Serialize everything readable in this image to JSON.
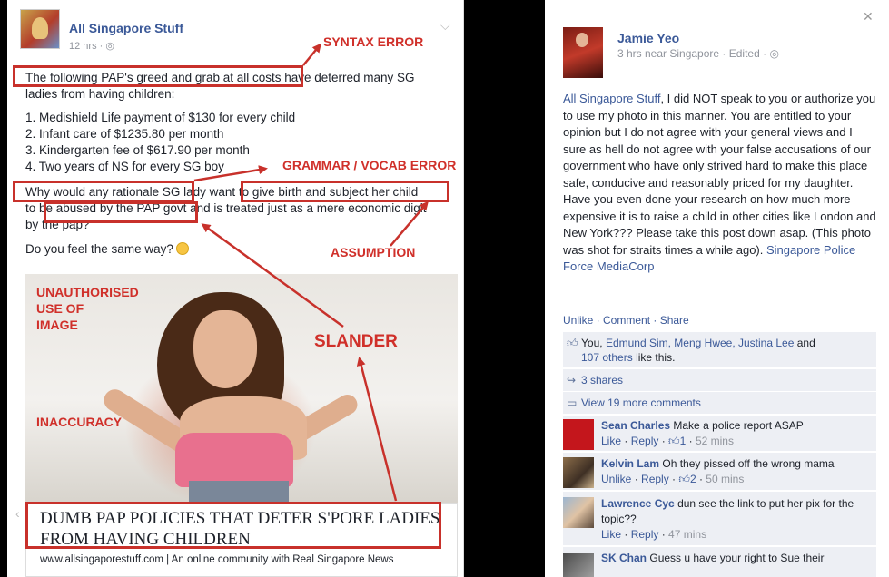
{
  "post": {
    "page_name": "All Singapore Stuff",
    "meta": "12 hrs · ",
    "text_lines": [
      "The following PAP's greed and grab at all costs have deterred many SG",
      "ladies from having children:"
    ],
    "list": [
      "1. Medishield Life payment of $130 for every child",
      "2. Infant care of $1235.80 per month",
      "3. Kindergarten fee of $617.90 per month",
      "4. Two years of NS for every SG boy"
    ],
    "text_lines_2": [
      "Why would any rationale SG lady want to give birth and subject her child",
      "to be abused by the PAP govt and is treated just as a mere economic digit",
      "by the pap?"
    ],
    "question": "Do you feel the same way?",
    "link_title_1": "DUMB PAP POLICIES THAT DETER S'PORE LADIES",
    "link_title_2": "FROM HAVING CHILDREN",
    "link_url": "www.allsingaporestuff.com | An online community with Real Singapore News"
  },
  "annotations": {
    "syntax": "SYNTAX ERROR",
    "grammar": "GRAMMAR / VOCAB ERROR",
    "assumption": "ASSUMPTION",
    "unauth_1": "UNAUTHORISED",
    "unauth_2": "USE OF",
    "unauth_3": "IMAGE",
    "slander": "SLANDER",
    "inaccuracy": "INACCURACY",
    "color": "#d0302a"
  },
  "reply": {
    "name": "Jamie Yeo",
    "meta": "3 hrs near Singapore · Edited · ",
    "body_link_1": "All Singapore Stuff",
    "body": ", I did NOT speak to you or authorize you to use my photo in this manner. You are entitled to your opinion but I do not agree with your general views and I sure as hell do not agree with your false accusations of our government who have only strived hard to make this place safe, conducive and reasonably priced for my daughter. Have you even done your research on how much more expensive it is to raise a child in other cities like London and New York??? Please take this post down asap. (This photo was shot for straits times a while ago).",
    "body_link_2": "Singapore Police Force",
    "body_link_3": "MediaCorp",
    "actions": "Unlike · Comment · Share",
    "likes_prefix": "You,",
    "likes_names": "Edmund Sim, Meng Hwee, Justina Lee",
    "likes_and": "and",
    "likes_others": "107 others",
    "likes_suffix": "like this.",
    "shares": "3 shares",
    "view_more": "View 19 more comments",
    "comments": [
      {
        "name": "Sean Charles",
        "text": "Make a police report ASAP",
        "action": "Like",
        "reply": "Reply",
        "likes": "1",
        "time": "52 mins"
      },
      {
        "name": "Kelvin Lam",
        "text": "Oh they pissed off the wrong mama",
        "action": "Unlike",
        "reply": "Reply",
        "likes": "2",
        "time": "50 mins"
      },
      {
        "name": "Lawrence Cyc",
        "text": "dun see the link to put her pix for the topic??",
        "action": "Like",
        "reply": "Reply",
        "likes": "",
        "time": "47 mins"
      },
      {
        "name": "SK Chan",
        "text": "Guess u have your right to Sue their",
        "action": "",
        "reply": "",
        "likes": "",
        "time": ""
      }
    ]
  }
}
